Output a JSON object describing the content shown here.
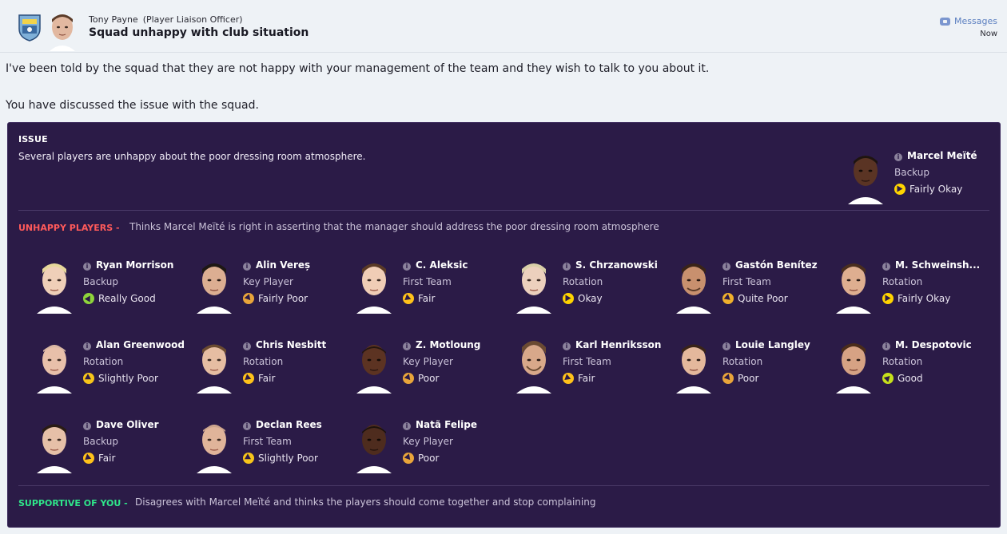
{
  "header": {
    "sender_name": "Tony Payne",
    "sender_role": "(Player Liaison Officer)",
    "subject": "Squad unhappy with club situation",
    "messages_label": "Messages",
    "time": "Now"
  },
  "body": {
    "line1": "I've been told by the squad that they are not happy with your management of the team and they wish to talk to you about it.",
    "line2": "You have discussed the issue with the squad."
  },
  "issue": {
    "title": "ISSUE",
    "description": "Several players are unhappy about the poor dressing room atmosphere.",
    "lead_player": {
      "name": "Marcel Meïté",
      "role": "Backup",
      "mood": "Fairly Okay"
    }
  },
  "unhappy": {
    "label": "UNHAPPY PLAYERS -",
    "description": "Thinks Marcel Meïté is right in asserting that the manager should address the poor dressing room atmosphere",
    "players": [
      {
        "name": "Ryan Morrison",
        "role": "Backup",
        "mood": "Really Good"
      },
      {
        "name": "Alin Vereș",
        "role": "Key Player",
        "mood": "Fairly Poor"
      },
      {
        "name": "C. Aleksic",
        "role": "First Team",
        "mood": "Fair"
      },
      {
        "name": "S. Chrzanowski",
        "role": "Rotation",
        "mood": "Okay"
      },
      {
        "name": "Gastón Benítez",
        "role": "First Team",
        "mood": "Quite Poor"
      },
      {
        "name": "M. Schweinsh...",
        "role": "Rotation",
        "mood": "Fairly Okay"
      },
      {
        "name": "Alan Greenwood",
        "role": "Rotation",
        "mood": "Slightly Poor"
      },
      {
        "name": "Chris Nesbitt",
        "role": "Rotation",
        "mood": "Fair"
      },
      {
        "name": "Z. Motloung",
        "role": "Key Player",
        "mood": "Poor"
      },
      {
        "name": "Karl Henriksson",
        "role": "First Team",
        "mood": "Fair"
      },
      {
        "name": "Louie Langley",
        "role": "Rotation",
        "mood": "Poor"
      },
      {
        "name": "M. Despotovic",
        "role": "Rotation",
        "mood": "Good"
      },
      {
        "name": "Dave Oliver",
        "role": "Backup",
        "mood": "Fair"
      },
      {
        "name": "Declan Rees",
        "role": "First Team",
        "mood": "Slightly Poor"
      },
      {
        "name": "Natã Felipe",
        "role": "Key Player",
        "mood": "Poor"
      }
    ]
  },
  "supportive": {
    "label": "SUPPORTIVE OF YOU -",
    "description": "Disagrees with Marcel Meïté and thinks the players should come together and stop complaining"
  },
  "colors": {
    "panel_bg": "#2b1b47",
    "unhappy_label": "#ff5a5a",
    "supportive_label": "#2fe68a",
    "link": "#5b7fc0"
  }
}
